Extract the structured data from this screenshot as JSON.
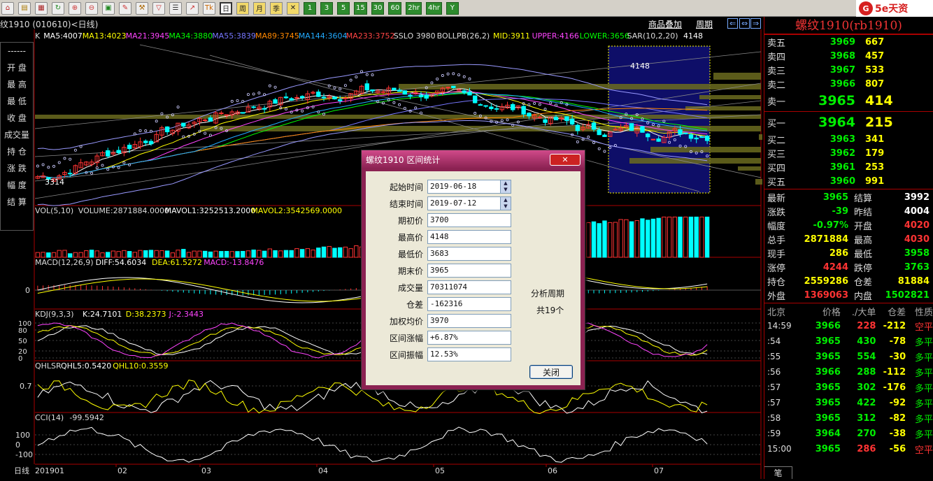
{
  "toolbar": {
    "buttons_left": [
      "home",
      "save",
      "chart",
      "refresh",
      "zoom-in",
      "zoom-out",
      "window",
      "pen",
      "tool",
      "filter",
      "list",
      "trend",
      "tick"
    ],
    "period_buttons": [
      "日",
      "周",
      "月",
      "季",
      "✕",
      "1",
      "3",
      "5",
      "15",
      "30",
      "60",
      "2hr",
      "4hr",
      "Y"
    ],
    "tick_label": "Tick"
  },
  "logo": {
    "mark": "G",
    "text": "5e天资"
  },
  "chart": {
    "contract_label": "纹1910 (010610)<日线)",
    "link_1": "商品叠加",
    "link_2": "周期",
    "main_indicators": [
      {
        "text": "K",
        "color": "#dddddd"
      },
      {
        "text": "MA5:4007",
        "color": "#ffffff"
      },
      {
        "text": "MA13:4023",
        "color": "#ffff00"
      },
      {
        "text": "MA21:3945",
        "color": "#ff44ff"
      },
      {
        "text": "MA34:3880",
        "color": "#00ff00"
      },
      {
        "text": "MA55:3839",
        "color": "#7777ff"
      },
      {
        "text": "MA89:3745",
        "color": "#ff8800"
      },
      {
        "text": "MA144:3604",
        "color": "#22aaff"
      },
      {
        "text": "MA233:3752",
        "color": "#ff4444"
      },
      {
        "text": "SSLO 3980",
        "color": "#dddddd"
      },
      {
        "text": "BOLLPB(26,2)",
        "color": "#dddddd"
      },
      {
        "text": "MID:3911",
        "color": "#ffff00"
      },
      {
        "text": "UPPER:4166",
        "color": "#ff44ff"
      },
      {
        "text": "LOWER:3656",
        "color": "#00ff00"
      },
      {
        "text": "SAR(10,2,20)",
        "color": "#dddddd"
      },
      {
        "text": "4148",
        "color": "#ffffff"
      }
    ],
    "high_label": "4148",
    "low_label": "3314",
    "vol_indicators": [
      {
        "text": "VOL(5,10)",
        "color": "#dddddd"
      },
      {
        "text": "VOLUME:2871884.0000",
        "color": "#dddddd"
      },
      {
        "text": "MAVOL1:3252513.2000",
        "color": "#ffffff"
      },
      {
        "text": "MAVOL2:3542569.0000",
        "color": "#ffff00"
      }
    ],
    "macd_indicators": [
      {
        "text": "MACD(12,26,9)",
        "color": "#dddddd"
      },
      {
        "text": "DIFF:54.6034",
        "color": "#ffffff"
      },
      {
        "text": "DEA:61.5272",
        "color": "#ffff00"
      },
      {
        "text": "MACD:-13.8476",
        "color": "#ff44ff"
      }
    ],
    "macd_axis": "0",
    "kdj_indicators": [
      {
        "text": "KDJ(9,3,3)",
        "color": "#dddddd"
      },
      {
        "text": "K:24.7101",
        "color": "#ffffff"
      },
      {
        "text": "D:38.2373",
        "color": "#ffff00"
      },
      {
        "text": "J:-2.3443",
        "color": "#ff44ff"
      }
    ],
    "kdj_axis": [
      "100",
      "80",
      "50",
      "20",
      "0"
    ],
    "qhlsr_indicators": [
      {
        "text": "QHLSR",
        "color": "#dddddd"
      },
      {
        "text": "QHL5:0.5420",
        "color": "#ffffff"
      },
      {
        "text": "QHL10:0.3559",
        "color": "#ffff00"
      }
    ],
    "qhlsr_axis": "0.7",
    "cci_indicators": [
      {
        "text": "CCI(14)",
        "color": "#dddddd"
      },
      {
        "text": "-99.5942",
        "color": "#dddddd"
      }
    ],
    "cci_axis": [
      "100",
      "0",
      "-100"
    ],
    "x_axis": [
      "日线",
      "201901",
      "02",
      "03",
      "04",
      "05",
      "06",
      "07"
    ]
  },
  "left_menu": {
    "items": [
      "------",
      "开  盘",
      "最  高",
      "最  低",
      "收  盘",
      "成交量",
      "持  仓",
      "涨  跌",
      "幅  度",
      "结  算"
    ]
  },
  "dialog": {
    "title": "螺纹1910 区间统计",
    "close_x": "✕",
    "fields": [
      {
        "label": "起始时间",
        "value": "2019-06-18",
        "spin": true
      },
      {
        "label": "结束时间",
        "value": "2019-07-12",
        "spin": true
      },
      {
        "label": "期初价",
        "value": "3700"
      },
      {
        "label": "最高价",
        "value": "4148"
      },
      {
        "label": "最低价",
        "value": "3683"
      },
      {
        "label": "期末价",
        "value": "3965"
      },
      {
        "label": "成交量",
        "value": "70311074"
      },
      {
        "label": "仓差",
        "value": "-162316"
      },
      {
        "label": "加权均价",
        "value": "3970"
      },
      {
        "label": "区间涨幅",
        "value": "+6.87%"
      },
      {
        "label": "区间振幅",
        "value": "12.53%"
      }
    ],
    "side_1": "分析周期",
    "side_2": "共19个",
    "close_button": "关闭"
  },
  "right_panel": {
    "title": "螺纹1910(rb1910)",
    "asks": [
      {
        "label": "卖五",
        "price": "3969",
        "vol": "667"
      },
      {
        "label": "卖四",
        "price": "3968",
        "vol": "457"
      },
      {
        "label": "卖三",
        "price": "3967",
        "vol": "533"
      },
      {
        "label": "卖二",
        "price": "3966",
        "vol": "807"
      },
      {
        "label": "卖一",
        "price": "3965",
        "vol": "414"
      }
    ],
    "bids": [
      {
        "label": "买一",
        "price": "3964",
        "vol": "215"
      },
      {
        "label": "买二",
        "price": "3963",
        "vol": "341"
      },
      {
        "label": "买三",
        "price": "3962",
        "vol": "179"
      },
      {
        "label": "买四",
        "price": "3961",
        "vol": "253"
      },
      {
        "label": "买五",
        "price": "3960",
        "vol": "991"
      }
    ],
    "quotes": [
      {
        "l1": "最新",
        "v1": "3965",
        "c1": "#00ee00",
        "l2": "结算",
        "v2": "3992",
        "c2": "#ffffff"
      },
      {
        "l1": "涨跌",
        "v1": "-39",
        "c1": "#00ee00",
        "l2": "昨结",
        "v2": "4004",
        "c2": "#ffffff"
      },
      {
        "l1": "幅度",
        "v1": "-0.97%",
        "c1": "#00ee00",
        "l2": "开盘",
        "v2": "4020",
        "c2": "#ff3333"
      },
      {
        "l1": "总手",
        "v1": "2871884",
        "c1": "#ffff00",
        "l2": "最高",
        "v2": "4030",
        "c2": "#ff3333"
      },
      {
        "l1": "现手",
        "v1": "286",
        "c1": "#ffff00",
        "l2": "最低",
        "v2": "3958",
        "c2": "#00ee00"
      },
      {
        "l1": "涨停",
        "v1": "4244",
        "c1": "#ff3333",
        "l2": "跌停",
        "v2": "3763",
        "c2": "#00ee00"
      },
      {
        "l1": "持仓",
        "v1": "2559286",
        "c1": "#ffff00",
        "l2": "仓差",
        "v2": "81884",
        "c2": "#ffff00"
      },
      {
        "l1": "外盘",
        "v1": "1369063",
        "c1": "#ff3333",
        "l2": "内盘",
        "v2": "1502821",
        "c2": "#00ee00"
      }
    ],
    "ticks_header": [
      "北京",
      "价格",
      "./大单",
      "仓差",
      "性质"
    ],
    "ticks": [
      {
        "t": "14:59",
        "p": "3966",
        "v": "228",
        "vc": "#ff3333",
        "d": "-212",
        "n": "空平",
        "nc": "#ff3333"
      },
      {
        "t": ":54",
        "p": "3965",
        "v": "430",
        "vc": "#00ee00",
        "d": "-78",
        "n": "多平",
        "nc": "#00ee00"
      },
      {
        "t": ":55",
        "p": "3965",
        "v": "554",
        "vc": "#00ee00",
        "d": "-30",
        "n": "多平",
        "nc": "#00ee00"
      },
      {
        "t": ":56",
        "p": "3966",
        "v": "288",
        "vc": "#00ee00",
        "d": "-112",
        "n": "多平",
        "nc": "#00ee00"
      },
      {
        "t": ":57",
        "p": "3965",
        "v": "302",
        "vc": "#00ee00",
        "d": "-176",
        "n": "多平",
        "nc": "#00ee00"
      },
      {
        "t": ":57",
        "p": "3965",
        "v": "422",
        "vc": "#00ee00",
        "d": "-92",
        "n": "多平",
        "nc": "#00ee00"
      },
      {
        "t": ":58",
        "p": "3965",
        "v": "312",
        "vc": "#00ee00",
        "d": "-82",
        "n": "多平",
        "nc": "#00ee00"
      },
      {
        "t": ":59",
        "p": "3964",
        "v": "270",
        "vc": "#00ee00",
        "d": "-38",
        "n": "多平",
        "nc": "#00ee00"
      },
      {
        "t": "15:00",
        "p": "3965",
        "v": "286",
        "vc": "#ff3333",
        "d": "-56",
        "n": "空平",
        "nc": "#ff3333"
      }
    ],
    "footer_tab": "笔"
  }
}
